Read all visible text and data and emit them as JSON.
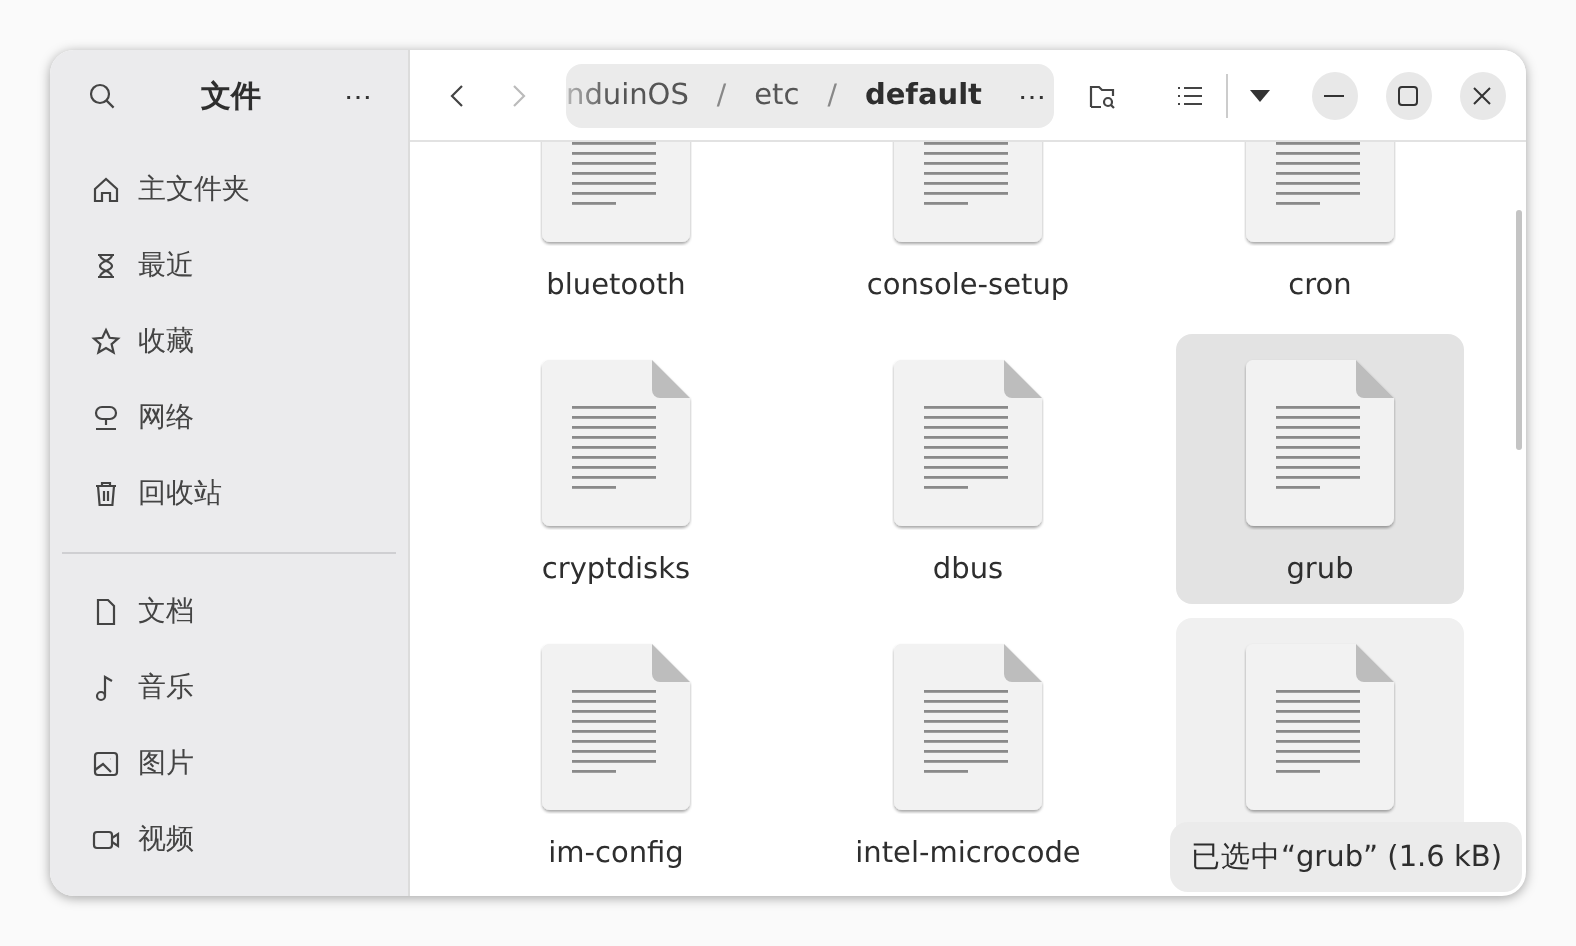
{
  "sidebar": {
    "title": "文件",
    "menu": "⋯",
    "places": [
      {
        "label": "主文件夹"
      },
      {
        "label": "最近"
      },
      {
        "label": "收藏"
      },
      {
        "label": "网络"
      },
      {
        "label": "回收站"
      }
    ],
    "folders": [
      {
        "label": "文档"
      },
      {
        "label": "音乐"
      },
      {
        "label": "图片"
      },
      {
        "label": "视频"
      }
    ]
  },
  "path": {
    "crumbs": [
      {
        "label": "nduinOS",
        "current": false
      },
      {
        "label": "etc",
        "current": false
      },
      {
        "label": "default",
        "current": true
      }
    ],
    "separator": "/",
    "menu": "⋯"
  },
  "files": [
    {
      "name": "bluetooth",
      "selected": false,
      "hovered": false
    },
    {
      "name": "console-setup",
      "selected": false,
      "hovered": false
    },
    {
      "name": "cron",
      "selected": false,
      "hovered": false
    },
    {
      "name": "cryptdisks",
      "selected": false,
      "hovered": false
    },
    {
      "name": "dbus",
      "selected": false,
      "hovered": false
    },
    {
      "name": "grub",
      "selected": true,
      "hovered": false
    },
    {
      "name": "im-config",
      "selected": false,
      "hovered": false
    },
    {
      "name": "intel-microcode",
      "selected": false,
      "hovered": false
    },
    {
      "selected": false,
      "hovered": true
    }
  ],
  "status": "已选中“grub” (1.6 kB)"
}
